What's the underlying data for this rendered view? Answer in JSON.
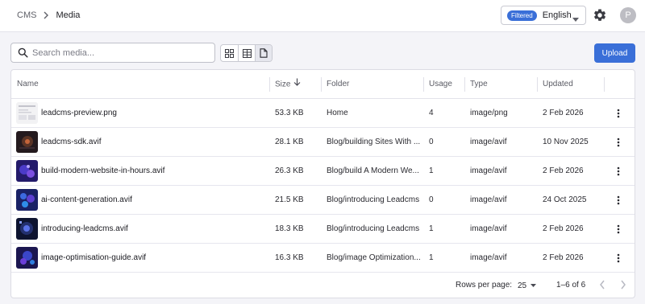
{
  "breadcrumb": {
    "root": "CMS",
    "current": "Media"
  },
  "language": {
    "badge": "Filtered",
    "value": "English"
  },
  "user": {
    "initial": "P"
  },
  "search": {
    "placeholder": "Search media..."
  },
  "toolbar": {
    "upload_label": "Upload",
    "active_view": "list"
  },
  "table": {
    "columns": {
      "name": "Name",
      "size": "Size",
      "folder": "Folder",
      "usage": "Usage",
      "type": "Type",
      "updated": "Updated"
    },
    "sort": {
      "column": "size",
      "direction": "descending"
    },
    "rows": [
      {
        "name": "leadcms-preview.png",
        "size": "53.3 KB",
        "folder": "Home",
        "usage": "4",
        "type": "image/png",
        "updated": "2 Feb 2026"
      },
      {
        "name": "leadcms-sdk.avif",
        "size": "28.1 KB",
        "folder": "Blog/building Sites With ...",
        "usage": "0",
        "type": "image/avif",
        "updated": "10 Nov 2025"
      },
      {
        "name": "build-modern-website-in-hours.avif",
        "size": "26.3 KB",
        "folder": "Blog/build A Modern We...",
        "usage": "1",
        "type": "image/avif",
        "updated": "2 Feb 2026"
      },
      {
        "name": "ai-content-generation.avif",
        "size": "21.5 KB",
        "folder": "Blog/introducing Leadcms",
        "usage": "0",
        "type": "image/avif",
        "updated": "24 Oct 2025"
      },
      {
        "name": "introducing-leadcms.avif",
        "size": "18.3 KB",
        "folder": "Blog/introducing Leadcms",
        "usage": "1",
        "type": "image/avif",
        "updated": "2 Feb 2026"
      },
      {
        "name": "image-optimisation-guide.avif",
        "size": "16.3 KB",
        "folder": "Blog/image Optimization...",
        "usage": "1",
        "type": "image/avif",
        "updated": "2 Feb 2026"
      }
    ]
  },
  "pagination": {
    "rows_per_page_label": "Rows per page:",
    "rows_per_page": "25",
    "range": "1–6 of 6"
  },
  "colors": {
    "accent": "#3a6fd8",
    "background": "#f4f4f8",
    "card": "#ffffff"
  }
}
